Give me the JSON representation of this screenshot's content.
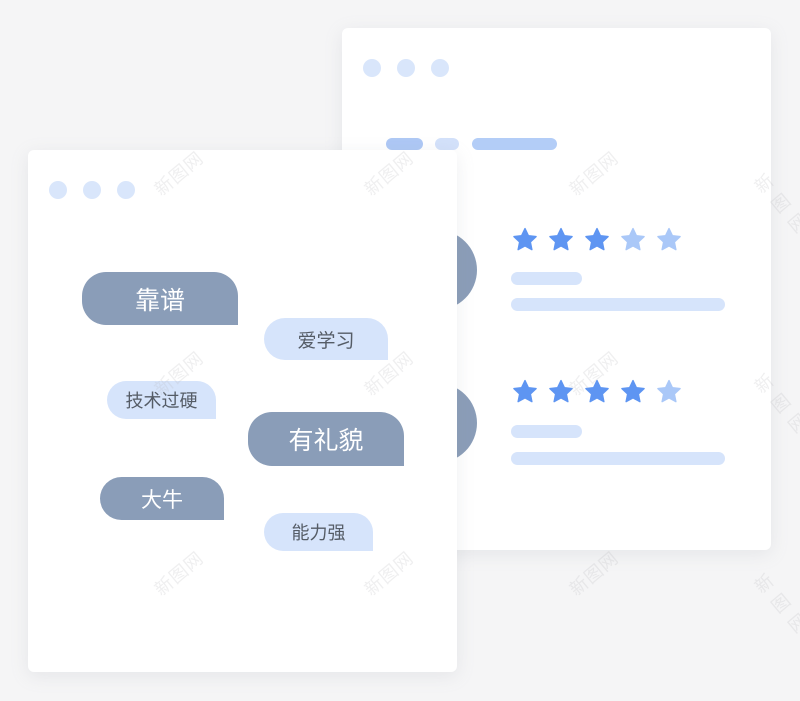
{
  "colors": {
    "background": "#f5f5f6",
    "card": "#ffffff",
    "dot": "#d9e6fb",
    "bubble_dark": "#8a9db8",
    "bubble_light": "#d6e4fb",
    "star_filled": "#5e95f2",
    "star_empty": "#aac8f8",
    "line": "#d6e4fb"
  },
  "back_window": {
    "tabs": [
      "",
      "",
      ""
    ],
    "reviews": [
      {
        "rating": 3,
        "max_rating": 5
      },
      {
        "rating": 4,
        "max_rating": 5
      }
    ]
  },
  "front_window": {
    "tags": [
      {
        "label": "靠谱",
        "style": "dark"
      },
      {
        "label": "爱学习",
        "style": "light"
      },
      {
        "label": "技术过硬",
        "style": "light"
      },
      {
        "label": "有礼貌",
        "style": "dark"
      },
      {
        "label": "大牛",
        "style": "dark"
      },
      {
        "label": "能力强",
        "style": "light"
      }
    ]
  },
  "watermark": "新图网"
}
